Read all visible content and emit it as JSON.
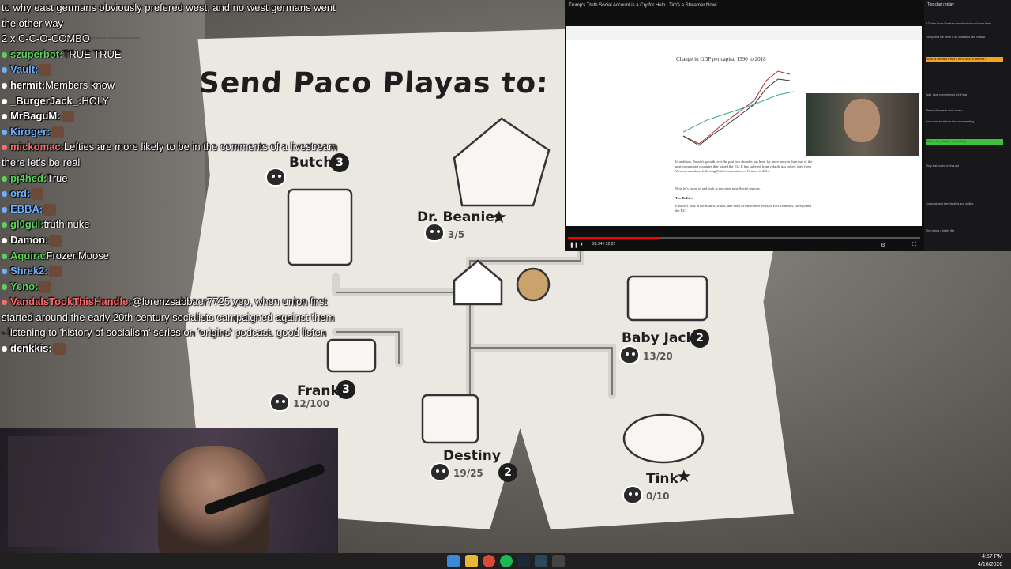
{
  "game": {
    "title": "Send Paco Playas to:",
    "locations": [
      {
        "name": "Butch",
        "badge": "3"
      },
      {
        "name": "Dr. Beanies",
        "count": "3/5"
      },
      {
        "name": "Baby Jack",
        "badge": "2",
        "count": "13/20"
      },
      {
        "name": "Frank",
        "badge": "3",
        "count": "12/100"
      },
      {
        "name": "Destiny",
        "badge": "2",
        "count": "19/25"
      },
      {
        "name": "Tink",
        "count": "0/10"
      }
    ]
  },
  "chat": {
    "messages": [
      {
        "user": "",
        "text": "to why east germans obviously prefered west, and no west germans went the other way",
        "color": "#ffffff"
      },
      {
        "user": "",
        "text": "2 x C-C-O-COMBO",
        "color": "#ffffff"
      },
      {
        "user": "szuperbot:",
        "text": "TRUE TRUE",
        "color": "#5dd35d"
      },
      {
        "user": "Vault:",
        "text": "",
        "color": "#6fb1ff"
      },
      {
        "user": "hermit:",
        "text": "Members know",
        "color": "#ffffff"
      },
      {
        "user": "_BurgerJack_:",
        "text": "HOLY",
        "color": "#ffffff"
      },
      {
        "user": "MrBaguM:",
        "text": "",
        "color": "#ffffff"
      },
      {
        "user": "Kiroger:",
        "text": "",
        "color": "#6fb1ff"
      },
      {
        "user": "mickomac:",
        "text": "Lefties are more likely to be in the comments of a livestream there let's be real",
        "color": "#ff6b6b"
      },
      {
        "user": "pj4hed:",
        "text": "True",
        "color": "#5dd35d"
      },
      {
        "user": "ord:",
        "text": "",
        "color": "#6fb1ff"
      },
      {
        "user": "EBBA:",
        "text": "",
        "color": "#6fb1ff"
      },
      {
        "user": "gl0gul:",
        "text": "truth nuke",
        "color": "#5dd35d"
      },
      {
        "user": "Damon:",
        "text": "",
        "color": "#ffffff"
      },
      {
        "user": "Aquira:",
        "text": "FrozenMoose",
        "color": "#5dd35d"
      },
      {
        "user": "Shrek2:",
        "text": "",
        "color": "#6fb1ff"
      },
      {
        "user": "Yeno:",
        "text": "",
        "color": "#5dd35d"
      },
      {
        "user": "VandalsTookThisHandle:",
        "text": "@lorenzsabbaer7725 yep, when union first started around the early 20th century socialists campaigned against them - listening to 'history of socialism' series on 'origins' podcast. good listen",
        "color": "#ff6b6b"
      },
      {
        "user": "denkkis:",
        "text": "",
        "color": "#ffffff"
      }
    ]
  },
  "video": {
    "title": "Trump's Truth Social Account is a Cry for Help | Tim's a Streamer Now!",
    "url": "noahpinion.blog/p/how-are-the-post-soviet-economies?...",
    "time": "28:34 / 52:22",
    "progress": 0.26,
    "chart_title": "Change in GDP per capita, 1990 to 2018",
    "article_lines": [
      "In addition, Russia's growth over the past two decades has been far more uneven than that of the post-communist countries that joined the EU. It has suffered from volatile gas prices, then from Western sanctions following Putin's annexation of Crimea in 2014.",
      "Now let's zoom in and look at the other post-Soviet regions.",
      "The Baltics",
      "First let's look at the Baltics, which, like most of the former Warsaw Pact countries, have joined the EU."
    ]
  },
  "side_chat": {
    "header": "Top chat replay",
    "messages": [
      "If Tucker loses Russia so much he should move there.",
      "Funny how the West is so obsessed with Russia",
      "Who is Hamas Pinto? Who has to defend?",
      "Wait, I just remembered all of that",
      "Please Ukraine is such a hero",
      "Just came back from the union meeting",
      "Come on, please, that's why",
      "They lost hopes on that aid",
      "Compose and then families and pulling",
      "This needs a better title"
    ]
  },
  "taskbar": {
    "time": "4:57 PM",
    "date": "4/16/2026"
  }
}
